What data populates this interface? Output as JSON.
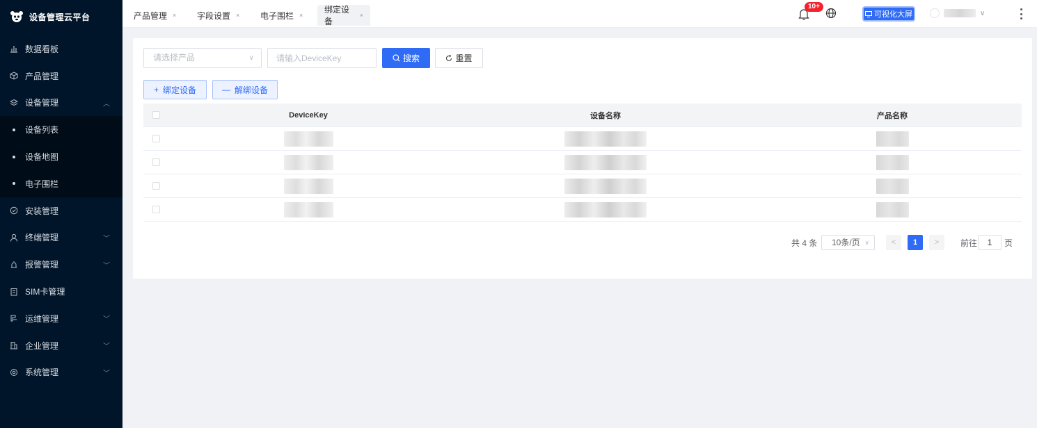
{
  "brand": {
    "title": "设备管理云平台"
  },
  "sidebar": {
    "items": [
      {
        "label": "数据看板",
        "icon": "bar-chart-icon"
      },
      {
        "label": "产品管理",
        "icon": "cube-icon"
      },
      {
        "label": "设备管理",
        "icon": "layers-icon",
        "expanded": true
      },
      {
        "label": "设备列表",
        "sub": true
      },
      {
        "label": "设备地图",
        "sub": true
      },
      {
        "label": "电子围栏",
        "sub": true
      },
      {
        "label": "安装管理",
        "icon": "check-circle-icon"
      },
      {
        "label": "终端管理",
        "icon": "user-icon"
      },
      {
        "label": "报警管理",
        "icon": "alarm-icon"
      },
      {
        "label": "SIM卡管理",
        "icon": "clipboard-icon"
      },
      {
        "label": "运维管理",
        "icon": "tool-icon"
      },
      {
        "label": "企业管理",
        "icon": "building-icon"
      },
      {
        "label": "系统管理",
        "icon": "gear-icon"
      }
    ]
  },
  "tabs": [
    {
      "label": "产品管理",
      "active": false
    },
    {
      "label": "字段设置",
      "active": false
    },
    {
      "label": "电子围栏",
      "active": false
    },
    {
      "label": "绑定设备",
      "active": true
    }
  ],
  "header": {
    "badge": "10+",
    "bigscreen_label": "可视化大屏",
    "close_glyph": "×"
  },
  "filters": {
    "product_placeholder": "请选择产品",
    "devicekey_placeholder": "请输入DeviceKey",
    "search_label": "搜索",
    "reset_label": "重置"
  },
  "actions": {
    "bind_label": "绑定设备",
    "unbind_label": "解绑设备"
  },
  "table": {
    "columns": [
      "DeviceKey",
      "设备名称",
      "产品名称"
    ],
    "row_count": 4
  },
  "pagination": {
    "total": "共 4 条",
    "page_size": "10条/页",
    "current": "1",
    "goto_label": "前往",
    "goto_value": "1",
    "unit": "页"
  },
  "colors": {
    "sidebar_bg": "#001529",
    "primary": "#2f6bf5",
    "badge": "#f5222d"
  }
}
